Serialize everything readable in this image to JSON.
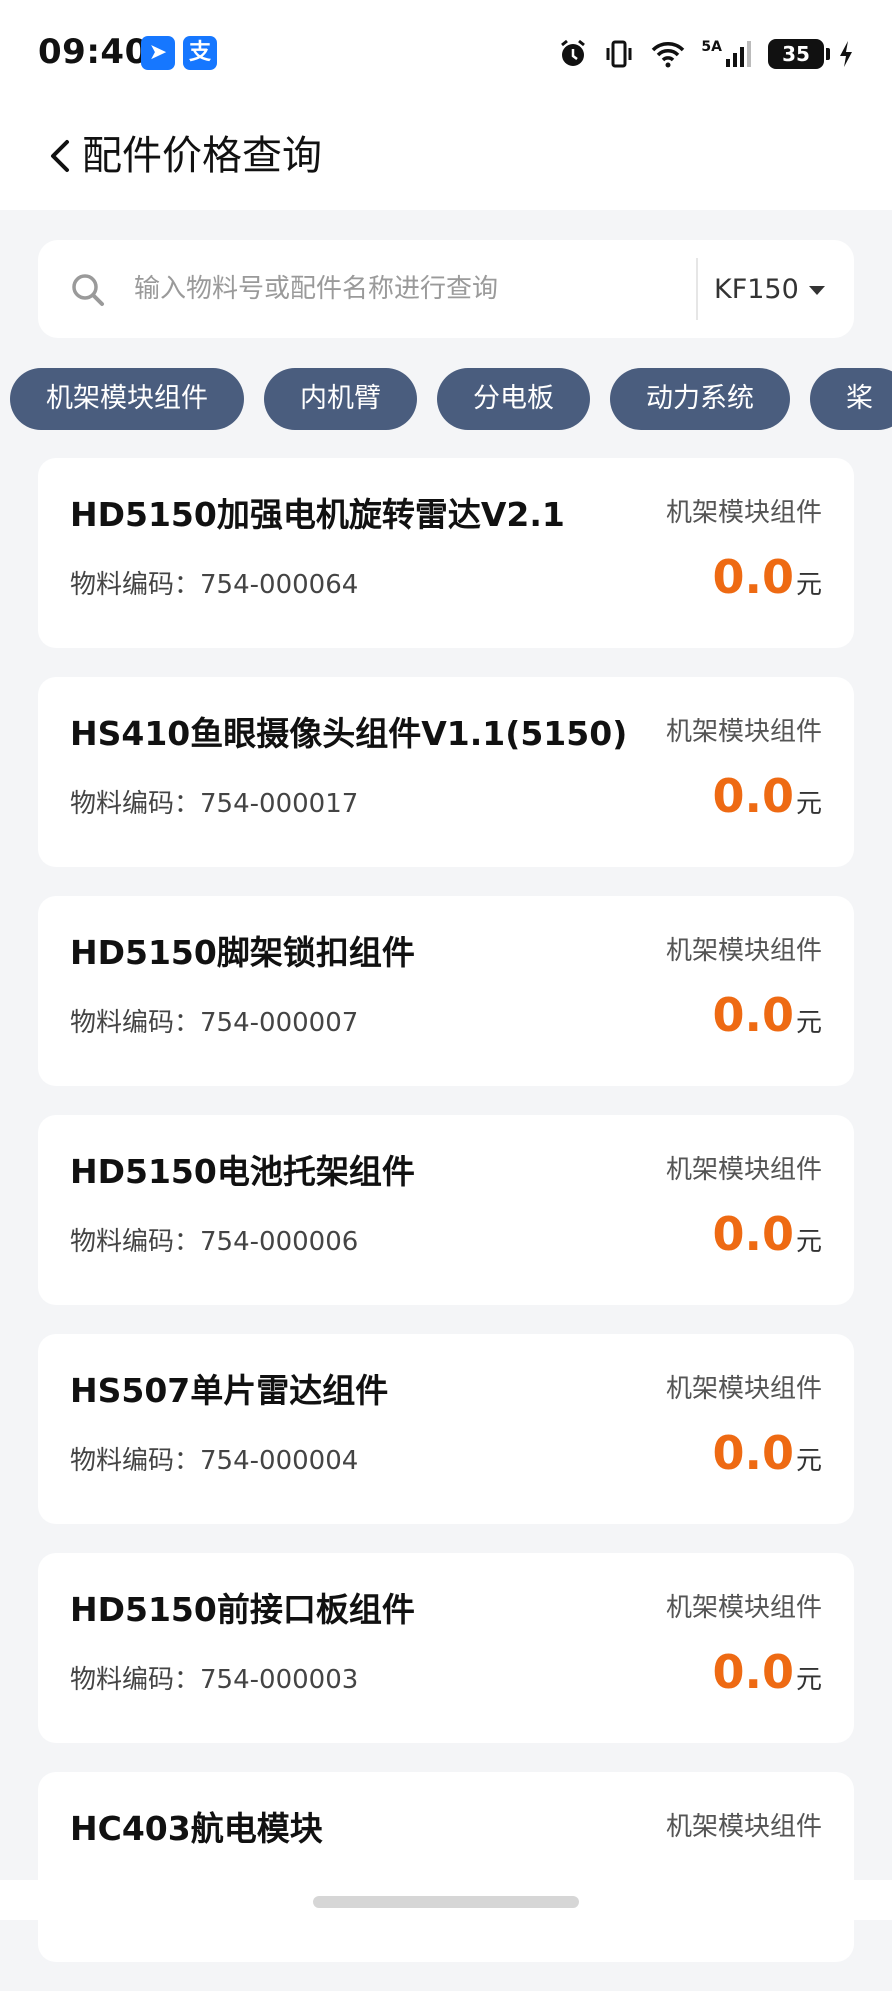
{
  "status_bar": {
    "time": "09:40",
    "app_badges": [
      "➤",
      "支"
    ],
    "network": "5A",
    "battery": "35",
    "icons": [
      "alarm-icon",
      "vibrate-icon",
      "wifi-icon",
      "signal-icon",
      "battery-icon",
      "charging-icon"
    ]
  },
  "header": {
    "title": "配件价格查询",
    "back_icon": "chevron-left-icon"
  },
  "search": {
    "placeholder": "输入物料号或配件名称进行查询",
    "value": "",
    "model": "KF150"
  },
  "categories": [
    {
      "label": "机架模块组件"
    },
    {
      "label": "内机臂"
    },
    {
      "label": "分电板"
    },
    {
      "label": "动力系统"
    },
    {
      "label": "桨"
    }
  ],
  "parts": [
    {
      "name": "HD5150加强电机旋转雷达V2.1",
      "category": "机架模块组件",
      "code_label": "物料编码：",
      "code": "754-000064",
      "price": "0.0",
      "unit": "元"
    },
    {
      "name": "HS410鱼眼摄像头组件V1.1(5150)",
      "category": "机架模块组件",
      "code_label": "物料编码：",
      "code": "754-000017",
      "price": "0.0",
      "unit": "元"
    },
    {
      "name": "HD5150脚架锁扣组件",
      "category": "机架模块组件",
      "code_label": "物料编码：",
      "code": "754-000007",
      "price": "0.0",
      "unit": "元"
    },
    {
      "name": "HD5150电池托架组件",
      "category": "机架模块组件",
      "code_label": "物料编码：",
      "code": "754-000006",
      "price": "0.0",
      "unit": "元"
    },
    {
      "name": "HS507单片雷达组件",
      "category": "机架模块组件",
      "code_label": "物料编码：",
      "code": "754-000004",
      "price": "0.0",
      "unit": "元"
    },
    {
      "name": "HD5150前接口板组件",
      "category": "机架模块组件",
      "code_label": "物料编码：",
      "code": "754-000003",
      "price": "0.0",
      "unit": "元"
    },
    {
      "name": "HC403航电模块",
      "category": "机架模块组件",
      "code_label": "",
      "code": "",
      "price": "",
      "unit": ""
    }
  ],
  "colors": {
    "accent": "#ee6a13",
    "chip_bg": "#4a5d7e",
    "page_bg": "#f4f5f7"
  }
}
